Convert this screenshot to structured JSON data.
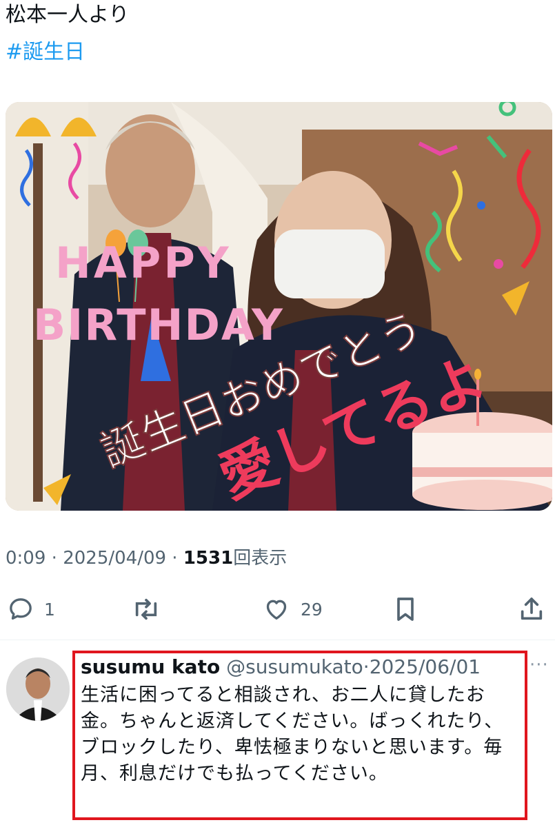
{
  "post": {
    "text": "松本一人より",
    "hashtag": "#誕生日"
  },
  "media": {
    "overlay": {
      "happy": "HAPPY",
      "birthday": "BIRTHDAY",
      "message_line1": "誕生日おめでとう",
      "message_line2": "愛してるよ"
    }
  },
  "meta": {
    "time": "0:09",
    "sep1": " · ",
    "date": "2025/04/09",
    "sep2": " · ",
    "views_count": "1531",
    "views_label": "回表示"
  },
  "actions": {
    "reply_count": "1",
    "like_count": "29"
  },
  "reply": {
    "name": "susumu kato",
    "handle": "@susumukato",
    "sep": "·",
    "date": "2025/06/01",
    "more": "···",
    "body": "生活に困ってると相談され、お二人に貸したお金。ちゃんと返済してください。ばっくれたり、ブロックしたり、卑怯極まりないと思います。毎月、利息だけでも払ってください。"
  },
  "colors": {
    "accent": "#1d9bf0",
    "highlight_box": "#e0161e",
    "muted": "#536471"
  }
}
